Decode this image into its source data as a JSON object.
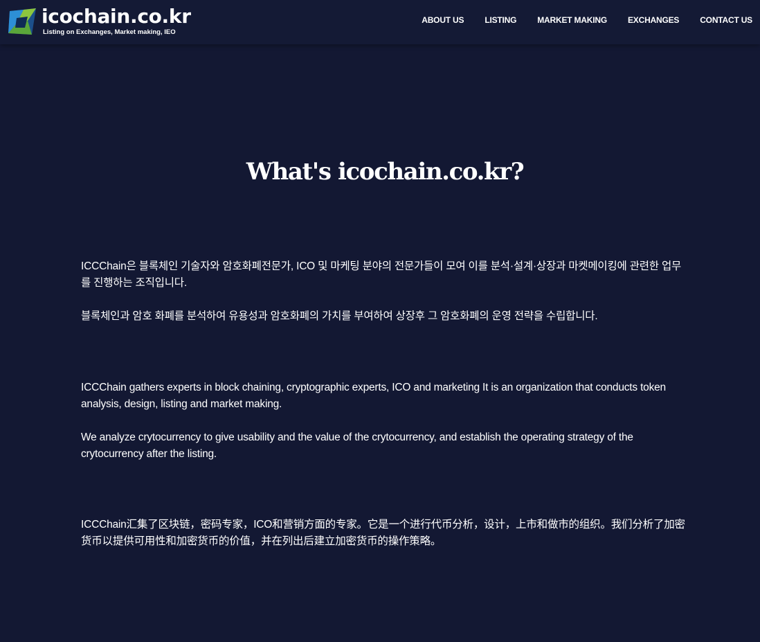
{
  "brand": {
    "title": "icochain.co.kr",
    "tagline": "Listing on Exchanges, Market making, IEO",
    "colors": {
      "logo_blue": "#2d8fd6",
      "logo_green": "#8cc63f",
      "logo_dark": "#1c4f8a"
    }
  },
  "nav": {
    "items": [
      {
        "label": "ABOUT US"
      },
      {
        "label": "LISTING"
      },
      {
        "label": "MARKET MAKING"
      },
      {
        "label": "EXCHANGES"
      },
      {
        "label": "CONTACT US"
      }
    ]
  },
  "main": {
    "title": "What's icochain.co.kr?",
    "korean": [
      "ICCChain은 블록체인 기술자와 암호화폐전문가, ICO 및 마케팅 분야의 전문가들이 모여 이를 분석·설계·상장과 마켓메이킹에 관련한 업무를 진행하는 조직입니다.",
      "블록체인과 암호 화폐를 분석하여 유용성과 암호화폐의 가치를 부여하여 상장후 그 암호화폐의 운영 전략을 수립합니다."
    ],
    "english": [
      "ICCChain gathers experts in block chaining, cryptographic experts, ICO and marketing It is an organization that conducts token analysis, design, listing and market making.",
      "We analyze crytocurrency to give usability and the value of the crytocurrency, and establish the operating strategy of the crytocurrency after the listing."
    ],
    "chinese": [
      "ICCChain汇集了区块链，密码专家，ICO和营销方面的专家。它是一个进行代币分析，设计，上市和做市的组织。我们分析了加密货币以提供可用性和加密货币的价值，并在列出后建立加密货币的操作策略。"
    ]
  },
  "colors": {
    "background": "#131833",
    "header_background": "#141a35",
    "text": "#ffffff"
  }
}
